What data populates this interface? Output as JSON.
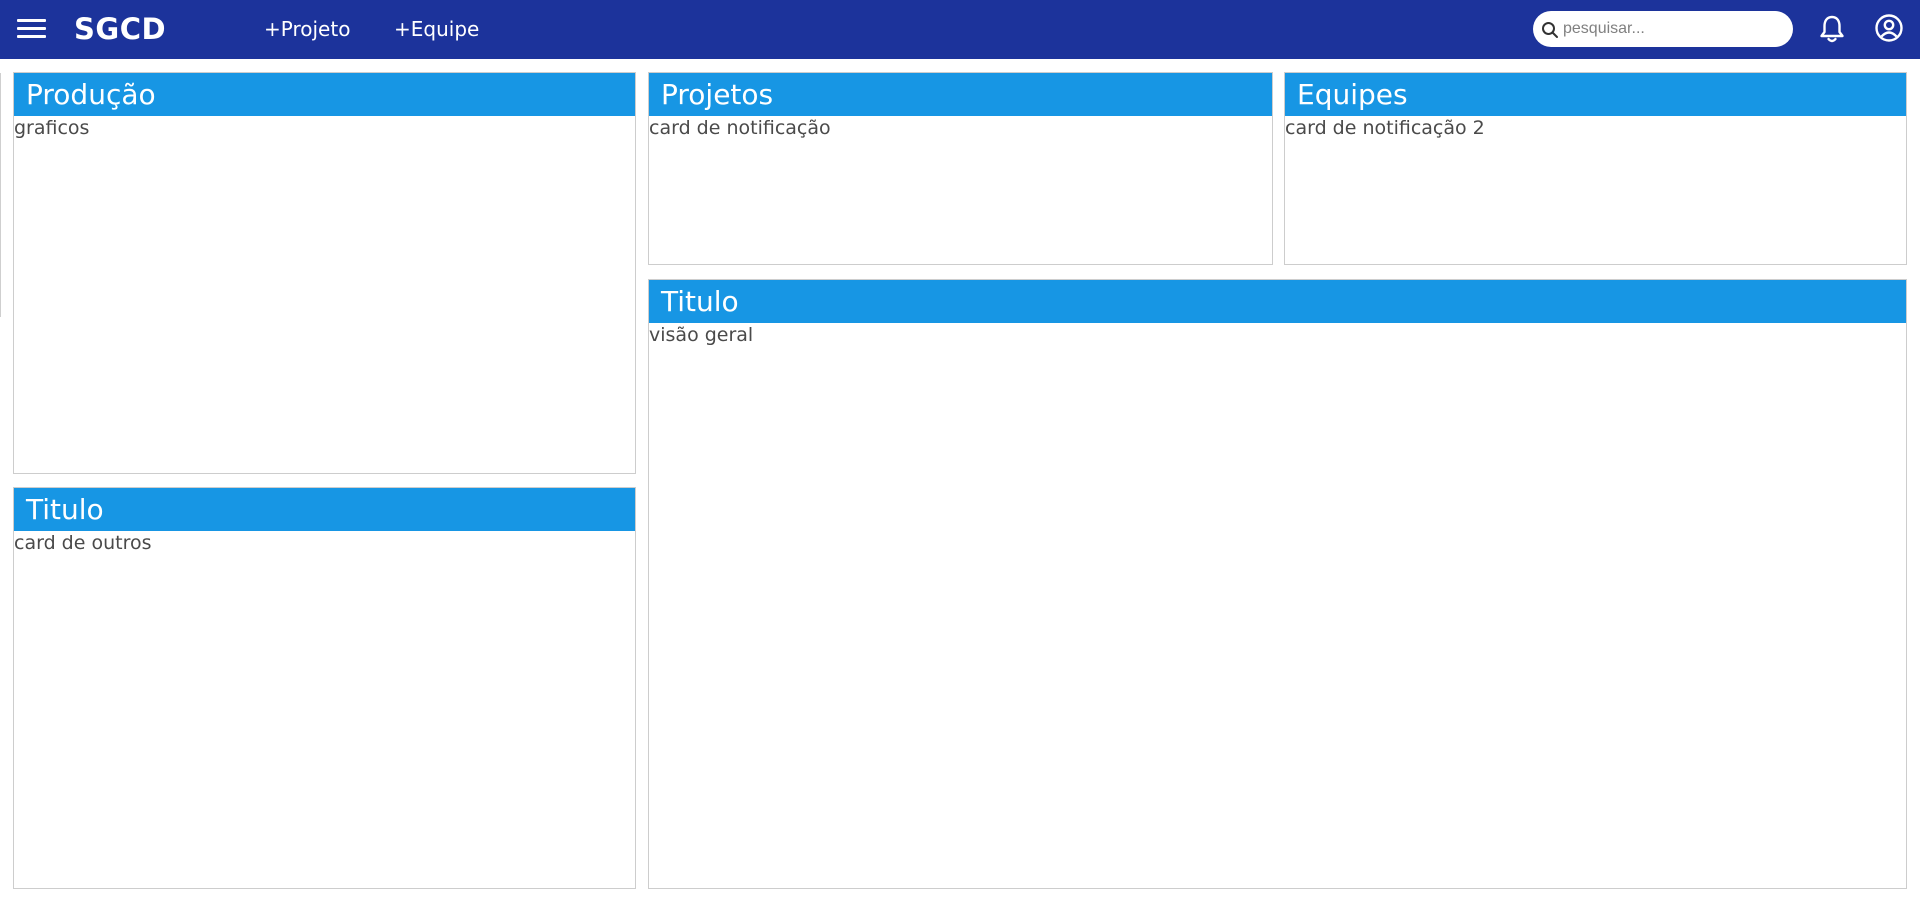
{
  "header": {
    "brand": "SGCD",
    "nav": [
      {
        "label": "+Projeto"
      },
      {
        "label": "+Equipe"
      }
    ],
    "search": {
      "placeholder": "pesquisar...",
      "value": ""
    },
    "icons": [
      "menu-icon",
      "search-icon",
      "bell-icon",
      "user-circle-icon"
    ],
    "colors": {
      "bar": "#1c339b"
    }
  },
  "cards": {
    "producao": {
      "title": "Produção",
      "body": "graficos"
    },
    "projetos": {
      "title": "Projetos",
      "body": "card de notificação"
    },
    "equipes": {
      "title": "Equipes",
      "body": "card de notificação 2"
    },
    "titulo_visao": {
      "title": "Titulo",
      "body": "visão geral"
    },
    "titulo_outros": {
      "title": "Titulo",
      "body": "card de outros"
    },
    "colors": {
      "header": "#1796e4",
      "border": "#cdcdcd"
    }
  }
}
